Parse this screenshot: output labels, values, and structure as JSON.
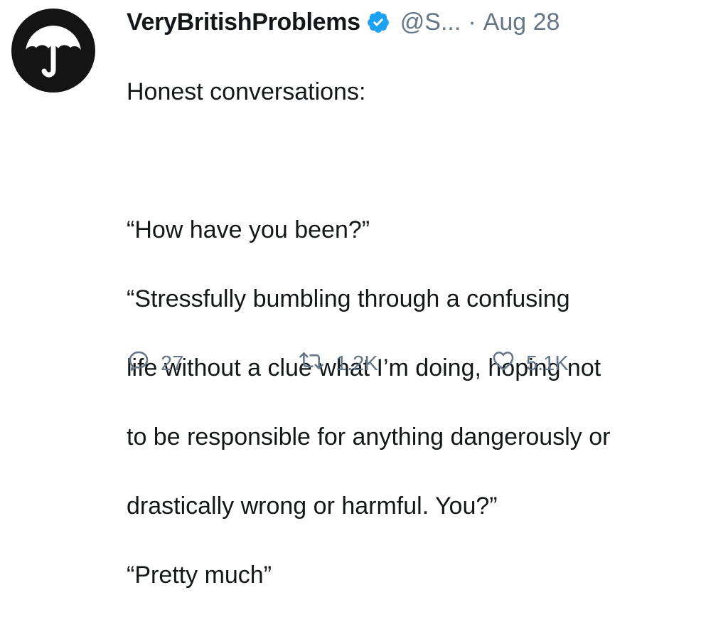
{
  "tweet": {
    "display_name": "VeryBritishProblems",
    "handle": "@S...",
    "separator": "·",
    "date": "Aug 28",
    "lines": [
      "Honest conversations:",
      "",
      "“How have you been?”",
      "“Stressfully bumbling through a confusing",
      "life without a clue what I’m doing, hoping not",
      "to be responsible for anything dangerously or",
      "drastically wrong or harmful. You?”",
      "“Pretty much”"
    ],
    "verified_icon": "verified-badge-icon",
    "avatar_icon": "umbrella-icon"
  },
  "actions": {
    "reply": {
      "icon": "reply-icon",
      "count": "27"
    },
    "retweet": {
      "icon": "retweet-icon",
      "count": "1.2K"
    },
    "like": {
      "icon": "heart-icon",
      "count": "5.1K"
    }
  },
  "colors": {
    "text": "#14171a",
    "secondary": "#657786",
    "verified": "#1da1f2",
    "avatar_bg": "#141414"
  }
}
